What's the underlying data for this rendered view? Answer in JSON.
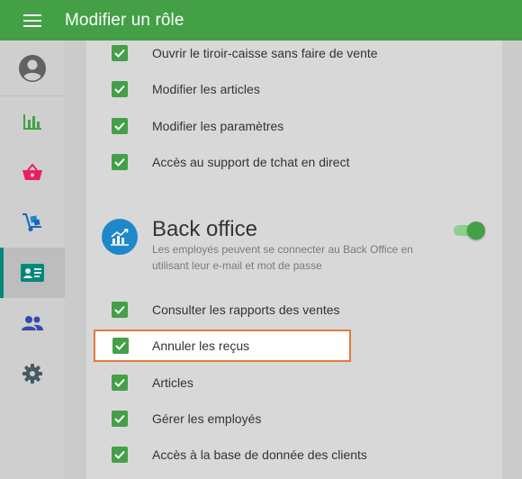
{
  "appbar": {
    "title": "Modifier un rôle",
    "menu_icon": "hamburger-menu-icon",
    "color": "#43a047"
  },
  "sidebar": {
    "items": [
      {
        "name": "avatar",
        "icon": "account-circle-icon"
      },
      {
        "name": "reports",
        "icon": "bar-chart-icon"
      },
      {
        "name": "sales",
        "icon": "basket-icon"
      },
      {
        "name": "inventory",
        "icon": "dolly-icon"
      },
      {
        "name": "employees",
        "icon": "id-card-icon",
        "active": true
      },
      {
        "name": "customers",
        "icon": "people-icon"
      },
      {
        "name": "settings",
        "icon": "gear-icon"
      }
    ]
  },
  "pos_permissions": [
    {
      "label": "Ouvrir le tiroir-caisse sans faire de vente",
      "checked": true
    },
    {
      "label": "Modifier les articles",
      "checked": true
    },
    {
      "label": "Modifier les paramètres",
      "checked": true
    },
    {
      "label": "Accès au support de tchat en direct",
      "checked": true
    }
  ],
  "back_office": {
    "title": "Back office",
    "description": "Les employés peuvent se connecter au Back Office en utilisant leur e-mail et mot de passe",
    "enabled": true,
    "icon": "analytics-icon",
    "icon_color": "#1e88c8"
  },
  "bo_permissions": [
    {
      "label": "Consulter les rapports des ventes",
      "checked": true
    },
    {
      "label": "Annuler les reçus",
      "checked": true,
      "highlighted": true
    },
    {
      "label": "Articles",
      "checked": true
    },
    {
      "label": "Gérer les employés",
      "checked": true
    },
    {
      "label": "Accès à la base de donnée des clients",
      "checked": true
    }
  ],
  "colors": {
    "accent": "#43a047",
    "highlight_border": "#e07b3e",
    "active_indicator": "#00897b"
  }
}
